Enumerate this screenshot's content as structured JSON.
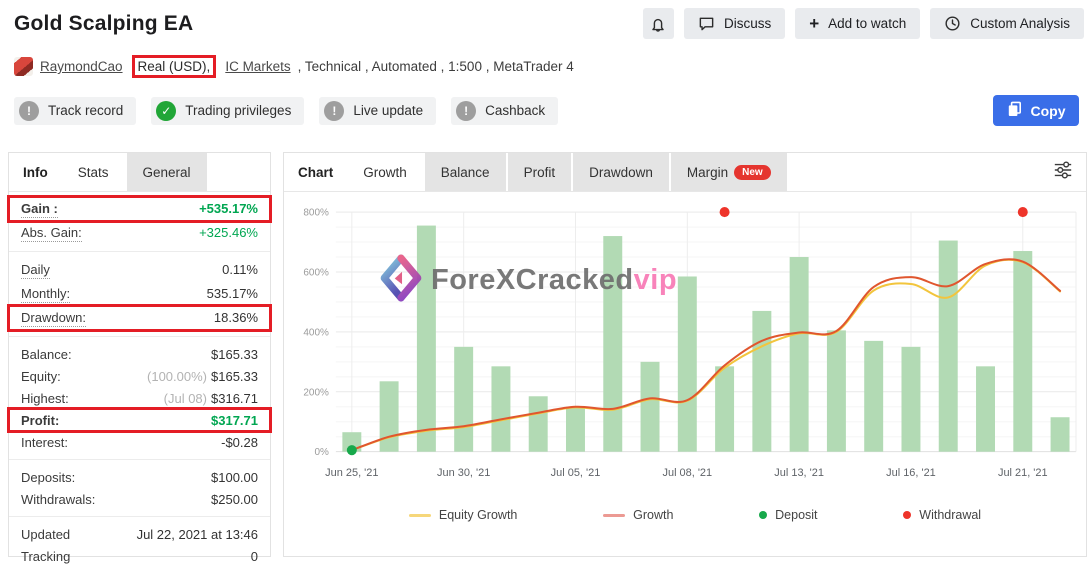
{
  "header": {
    "title": "Gold Scalping EA",
    "author": "RaymondCao",
    "account_type": "Real (USD),",
    "broker": "IC Markets",
    "meta_rest": ", Technical , Automated , 1:500 , MetaTrader 4",
    "buttons": {
      "discuss": "Discuss",
      "add_to_watch": "Add to watch",
      "custom_analysis": "Custom Analysis",
      "copy": "Copy"
    },
    "badges": [
      {
        "label": "Track record",
        "status": "warn"
      },
      {
        "label": "Trading privileges",
        "status": "ok"
      },
      {
        "label": "Live update",
        "status": "warn"
      },
      {
        "label": "Cashback",
        "status": "warn"
      }
    ]
  },
  "stats_panel": {
    "tabs": [
      "Info",
      "Stats",
      "General"
    ],
    "rows": [
      {
        "label": "Gain :",
        "value": "+535.17%"
      },
      {
        "label": "Abs. Gain:",
        "value": "+325.46%"
      },
      {
        "label": "Daily",
        "value": "0.11%"
      },
      {
        "label": "Monthly:",
        "value": "535.17%"
      },
      {
        "label": "Drawdown:",
        "value": "18.36%"
      },
      {
        "label": "Balance:",
        "value": "$165.33"
      },
      {
        "label": "Equity:",
        "prefix": "(100.00%)",
        "value": "$165.33"
      },
      {
        "label": "Highest:",
        "prefix": "(Jul 08)",
        "value": "$316.71"
      },
      {
        "label": "Profit:",
        "value": "$317.71"
      },
      {
        "label": "Interest:",
        "value": "-$0.28"
      },
      {
        "label": "Deposits:",
        "value": "$100.00"
      },
      {
        "label": "Withdrawals:",
        "value": "$250.00"
      },
      {
        "label": "Updated",
        "value": "Jul 22, 2021 at 13:46"
      },
      {
        "label": "Tracking",
        "value": "0"
      }
    ]
  },
  "chart_panel": {
    "tabs": [
      "Chart",
      "Growth",
      "Balance",
      "Profit",
      "Drawdown",
      "Margin"
    ],
    "margin_badge": "New",
    "watermark": {
      "text": "ForeXCracked",
      "suffix": "vip"
    }
  },
  "chart_data": {
    "type": "bar",
    "title": "Growth",
    "ylabel": "%",
    "ylim": [
      0,
      800
    ],
    "y_ticks": [
      0,
      200,
      400,
      600,
      800
    ],
    "grid": true,
    "legend_position": "bottom",
    "categories": [
      {
        "label": "Jun 25, '21"
      },
      {
        "label": ""
      },
      {
        "label": ""
      },
      {
        "label": "Jun 30, '21"
      },
      {
        "label": ""
      },
      {
        "label": ""
      },
      {
        "label": "Jul 05, '21"
      },
      {
        "label": ""
      },
      {
        "label": ""
      },
      {
        "label": "Jul 08, '21"
      },
      {
        "label": ""
      },
      {
        "label": ""
      },
      {
        "label": "Jul 13, '21"
      },
      {
        "label": ""
      },
      {
        "label": ""
      },
      {
        "label": "Jul 16, '21"
      },
      {
        "label": ""
      },
      {
        "label": ""
      },
      {
        "label": "Jul 21, '21"
      },
      {
        "label": ""
      }
    ],
    "bars": {
      "name": "daily-growth-bars",
      "color": "#b2dab4",
      "values": [
        65,
        235,
        755,
        350,
        285,
        185,
        150,
        720,
        300,
        585,
        285,
        470,
        650,
        405,
        370,
        350,
        705,
        285,
        670,
        115
      ]
    },
    "series": [
      {
        "name": "Equity Growth",
        "color": "#f2c53d",
        "values": [
          5,
          48,
          70,
          82,
          105,
          128,
          148,
          140,
          175,
          170,
          280,
          352,
          395,
          400,
          538,
          560,
          515,
          622,
          633,
          535
        ]
      },
      {
        "name": "Growth",
        "color": "#e0562e",
        "values": [
          5,
          50,
          73,
          85,
          108,
          130,
          150,
          143,
          178,
          172,
          288,
          370,
          398,
          403,
          550,
          583,
          553,
          627,
          635,
          537
        ]
      }
    ],
    "markers": {
      "deposit": {
        "color": "#17a94b",
        "points": [
          {
            "index": 0,
            "value": 5
          }
        ]
      },
      "withdrawal": {
        "color": "#ee342a",
        "points": [
          {
            "index": 10,
            "value": 800
          },
          {
            "index": 18,
            "value": 800
          }
        ]
      }
    },
    "legend": [
      {
        "label": "Equity Growth",
        "swatch": "line",
        "color": "#f6d77a"
      },
      {
        "label": "Growth",
        "swatch": "line",
        "color": "#ec9a93"
      },
      {
        "label": "Deposit",
        "swatch": "dot",
        "color": "#17a94b"
      },
      {
        "label": "Withdrawal",
        "swatch": "dot",
        "color": "#ee342a"
      }
    ]
  }
}
